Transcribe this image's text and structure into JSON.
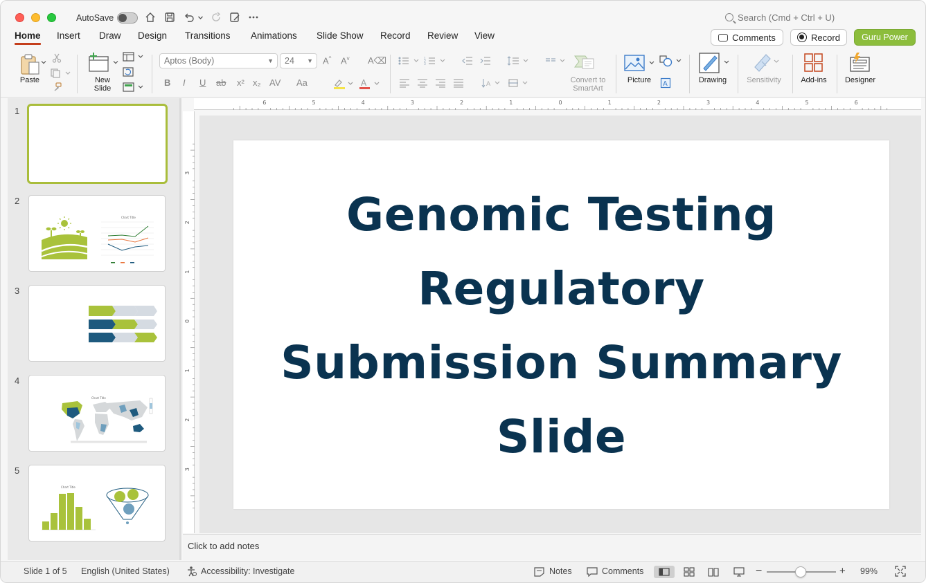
{
  "titlebar": {
    "autosave_label": "AutoSave",
    "autosave_on": false,
    "search_placeholder": "Search (Cmd + Ctrl + U)"
  },
  "tabs": [
    {
      "label": "Home",
      "active": true
    },
    {
      "label": "Insert",
      "active": false
    },
    {
      "label": "Draw",
      "active": false
    },
    {
      "label": "Design",
      "active": false
    },
    {
      "label": "Transitions",
      "active": false
    },
    {
      "label": "Animations",
      "active": false
    },
    {
      "label": "Slide Show",
      "active": false
    },
    {
      "label": "Record",
      "active": false
    },
    {
      "label": "Review",
      "active": false
    },
    {
      "label": "View",
      "active": false
    }
  ],
  "top_buttons": {
    "comments": "Comments",
    "record": "Record",
    "guru": "Guru Power"
  },
  "ribbon": {
    "paste": "Paste",
    "new_slide": "New Slide",
    "font_name": "Aptos (Body)",
    "font_size": "24",
    "convert_smartart": "Convert to SmartArt",
    "picture": "Picture",
    "drawing": "Drawing",
    "sensitivity": "Sensitivity",
    "addins": "Add-ins",
    "designer": "Designer"
  },
  "thumbnails": {
    "numbers": [
      "1",
      "2",
      "3",
      "4",
      "5"
    ],
    "selected_index": 0,
    "slide2_chart_title": "Chart Title",
    "slide4_chart_title": "Chart Title",
    "slide5_chart_title": "Chart Title"
  },
  "rulers": {
    "horizontal": [
      "6",
      "5",
      "4",
      "3",
      "2",
      "1",
      "0",
      "1",
      "2",
      "3",
      "4",
      "5",
      "6"
    ],
    "vertical": [
      "3",
      "2",
      "1",
      "0",
      "1",
      "2",
      "3"
    ]
  },
  "slide": {
    "title_lines": [
      "Genomic Testing",
      "Regulatory",
      "Submission Summary",
      "Slide"
    ]
  },
  "notes_placeholder": "Click to add notes",
  "status": {
    "slide_indicator": "Slide 1 of 5",
    "language": "English (United States)",
    "accessibility": "Accessibility: Investigate",
    "notes": "Notes",
    "comments": "Comments",
    "zoom": "99%"
  },
  "colors": {
    "accent_tab_underline": "#c43e1c",
    "guru_button": "#8cbd3c",
    "slide_title": "#0a3350",
    "thumb_green": "#a9c23b",
    "thumb_blue": "#1e5a7e"
  }
}
